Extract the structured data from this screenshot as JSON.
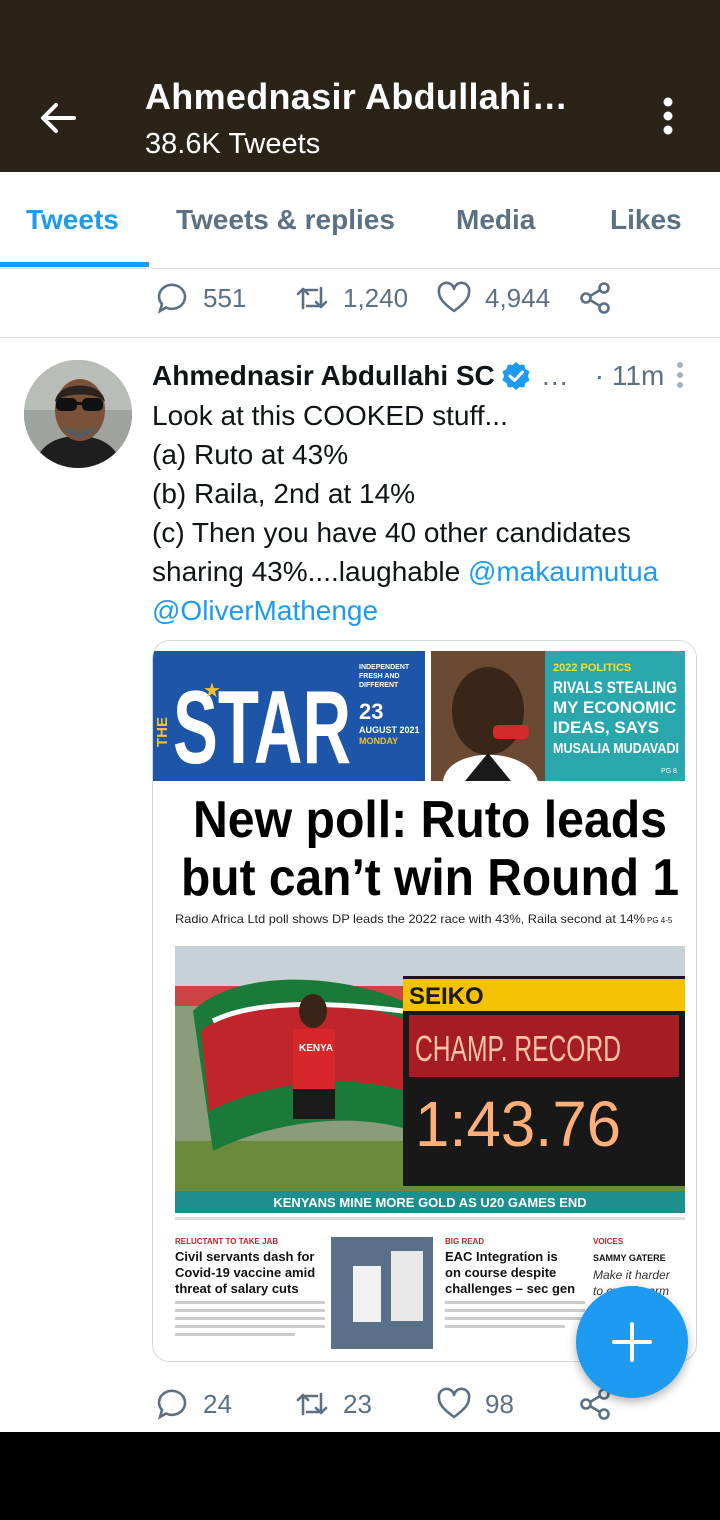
{
  "header": {
    "title": "Ahmednasir Abdullahi…",
    "tweet_count": "38.6K Tweets"
  },
  "tabs": [
    {
      "label": "Tweets"
    },
    {
      "label": "Tweets & replies"
    },
    {
      "label": "Media"
    },
    {
      "label": "Likes"
    }
  ],
  "prev_tweet_stats": {
    "replies": "551",
    "retweets": "1,240",
    "likes": "4,944"
  },
  "tweet": {
    "author": "Ahmednasir Abdullahi SC",
    "handle": "…",
    "time": "· 11m",
    "lines": [
      "Look at this COOKED stuff...",
      "(a) Ruto at 43%",
      "(b) Raila, 2nd at 14%",
      "(c) Then you have 40 other candidates",
      "sharing 43%....laughable "
    ],
    "mention1": "@makaumutua",
    "mention2": "@OliverMathenge",
    "stats": {
      "replies": "24",
      "retweets": "23",
      "likes": "98"
    }
  },
  "newspaper": {
    "masthead": "STAR",
    "the": "THE",
    "tagline1": "INDEPENDENT",
    "tagline2": "FRESH AND",
    "tagline3": "DIFFERENT",
    "date_day": "23",
    "date_month": "AUGUST 2021",
    "weekday": "MONDAY",
    "politics_kicker": "2022 POLITICS",
    "politics_head1": "RIVALS STEALING",
    "politics_head2": "MY ECONOMIC",
    "politics_head3": "IDEAS, SAYS",
    "politics_head4": "MUSALIA MUDAVADI",
    "politics_page": "PG 8",
    "headline1": "New poll: Ruto leads",
    "headline2": "but can’t win Round 1",
    "standfirst": "Radio Africa Ltd poll shows DP leads the 2022 race with 43%, Raila second at 14%",
    "standfirst_pg": "PG 4-5",
    "board_brand": "SEIKO",
    "board_record": "CHAMP. RECORD",
    "board_time": "1:43.76",
    "shirt": "KENYA",
    "photo_caption": "KENYANS MINE MORE GOLD AS U20 GAMES END",
    "col1_kicker": "RELUCTANT TO TAKE JAB",
    "col1_head1": "Civil servants dash for",
    "col1_head2": "Covid-19 vaccine amid",
    "col1_head3": "threat of salary cuts",
    "col2_kicker": "BIG READ",
    "col2_head1": "EAC Integration is",
    "col2_head2": "on course despite",
    "col2_head3": "challenges – sec gen",
    "col3_kicker": "VOICES",
    "col3_name": "SAMMY GATERE",
    "col3_text1": "Make it harder",
    "col3_text2": "to own firearm"
  },
  "colors": {
    "accent": "#1d9bf0",
    "header_bg": "#2b2218",
    "star_blue": "#1d55a8",
    "teal": "#2aa6ad"
  }
}
